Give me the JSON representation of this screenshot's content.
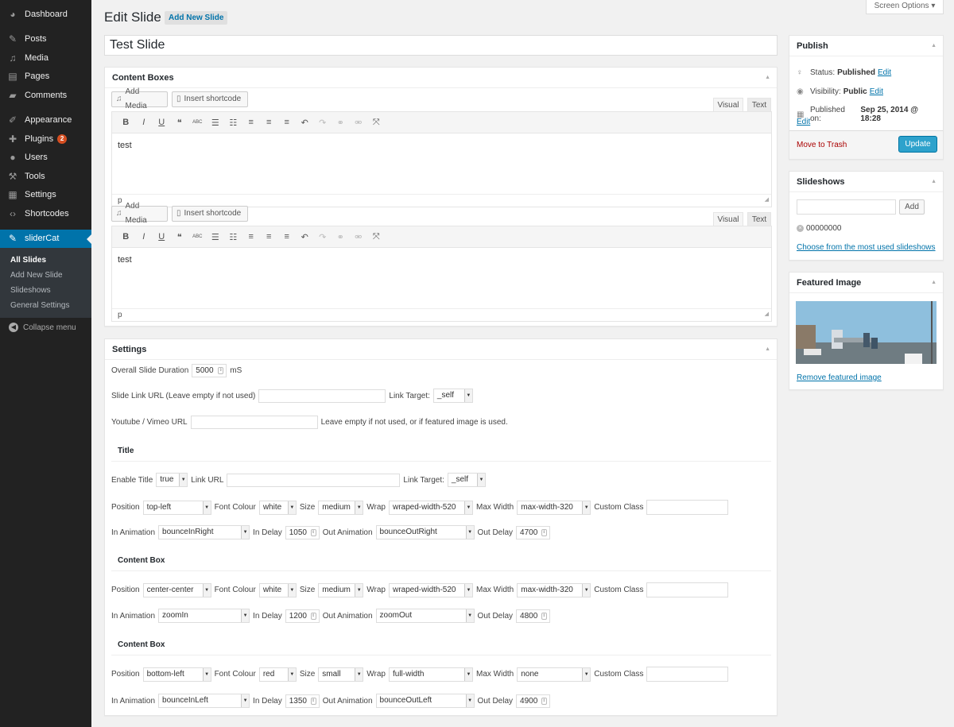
{
  "sidebar": {
    "items": [
      {
        "label": "Dashboard",
        "icon": "dashboard-icon"
      },
      {
        "label": "Posts",
        "icon": "pin-icon"
      },
      {
        "label": "Media",
        "icon": "media-icon"
      },
      {
        "label": "Pages",
        "icon": "pages-icon"
      },
      {
        "label": "Comments",
        "icon": "comment-icon"
      },
      {
        "label": "Appearance",
        "icon": "brush-icon"
      },
      {
        "label": "Plugins",
        "icon": "plugin-icon",
        "badge": "2"
      },
      {
        "label": "Users",
        "icon": "user-icon"
      },
      {
        "label": "Tools",
        "icon": "wrench-icon"
      },
      {
        "label": "Settings",
        "icon": "settings-icon"
      },
      {
        "label": "Shortcodes",
        "icon": "code-icon"
      },
      {
        "label": "sliderCat",
        "icon": "pin-icon"
      }
    ],
    "submenu": [
      "All Slides",
      "Add New Slide",
      "Slideshows",
      "General Settings"
    ],
    "collapse_label": "Collapse menu"
  },
  "header": {
    "title": "Edit Slide",
    "add_new_label": "Add New Slide",
    "screen_options_label": "Screen Options ▾"
  },
  "post_title": "Test Slide",
  "content_boxes": {
    "title": "Content Boxes",
    "add_media_label": "Add Media",
    "insert_shortcode_label": "Insert shortcode",
    "visual_tab": "Visual",
    "text_tab": "Text",
    "editors": [
      {
        "content": "test",
        "path": "p"
      },
      {
        "content": "test",
        "path": "p"
      }
    ]
  },
  "settings": {
    "title": "Settings",
    "duration_label": "Overall Slide Duration",
    "duration_value": "5000",
    "duration_unit": "mS",
    "link_url_label": "Slide Link URL (Leave empty if not used)",
    "link_url_value": "",
    "link_target_label": "Link Target:",
    "link_target_value": "_self",
    "video_label": "Youtube / Vimeo URL",
    "video_value": "",
    "video_hint": "Leave empty if not used, or if featured image is used.",
    "labels": {
      "enable_title": "Enable Title",
      "link_url": "Link URL",
      "link_target": "Link Target:",
      "position": "Position",
      "font_colour": "Font Colour",
      "size": "Size",
      "wrap": "Wrap",
      "max_width": "Max Width",
      "custom_class": "Custom Class",
      "in_animation": "In Animation",
      "in_delay": "In Delay",
      "out_animation": "Out Animation",
      "out_delay": "Out Delay"
    },
    "blocks": [
      {
        "heading": "Title",
        "enable_title": "true",
        "link_url": "",
        "link_target": "_self",
        "position": "top-left",
        "font_colour": "white",
        "size": "medium",
        "wrap": "wraped-width-520",
        "max_width": "max-width-320",
        "custom_class": "",
        "in_animation": "bounceInRight",
        "in_delay": "1050",
        "out_animation": "bounceOutRight",
        "out_delay": "4700"
      },
      {
        "heading": "Content Box",
        "position": "center-center",
        "font_colour": "white",
        "size": "medium",
        "wrap": "wraped-width-520",
        "max_width": "max-width-320",
        "custom_class": "",
        "in_animation": "zoomIn",
        "in_delay": "1200",
        "out_animation": "zoomOut",
        "out_delay": "4800"
      },
      {
        "heading": "Content Box",
        "position": "bottom-left",
        "font_colour": "red",
        "size": "small",
        "wrap": "full-width",
        "max_width": "none",
        "custom_class": "",
        "in_animation": "bounceInLeft",
        "in_delay": "1350",
        "out_animation": "bounceOutLeft",
        "out_delay": "4900"
      }
    ]
  },
  "publish": {
    "title": "Publish",
    "status_label": "Status:",
    "status_value": "Published",
    "visibility_label": "Visibility:",
    "visibility_value": "Public",
    "published_label": "Published on:",
    "published_value": "Sep 25, 2014 @ 18:28",
    "edit_label": "Edit",
    "trash_label": "Move to Trash",
    "update_label": "Update"
  },
  "slideshows": {
    "title": "Slideshows",
    "input_value": "",
    "add_label": "Add",
    "tag": "00000000",
    "choose_link": "Choose from the most used slideshows"
  },
  "featured_image": {
    "title": "Featured Image",
    "remove_link": "Remove featured image"
  },
  "colors": {
    "sidebar_bg": "#222222",
    "accent": "#0073aa",
    "update_button": "#2ea2cc",
    "trash": "#aa0000",
    "badge": "#d54e21"
  }
}
